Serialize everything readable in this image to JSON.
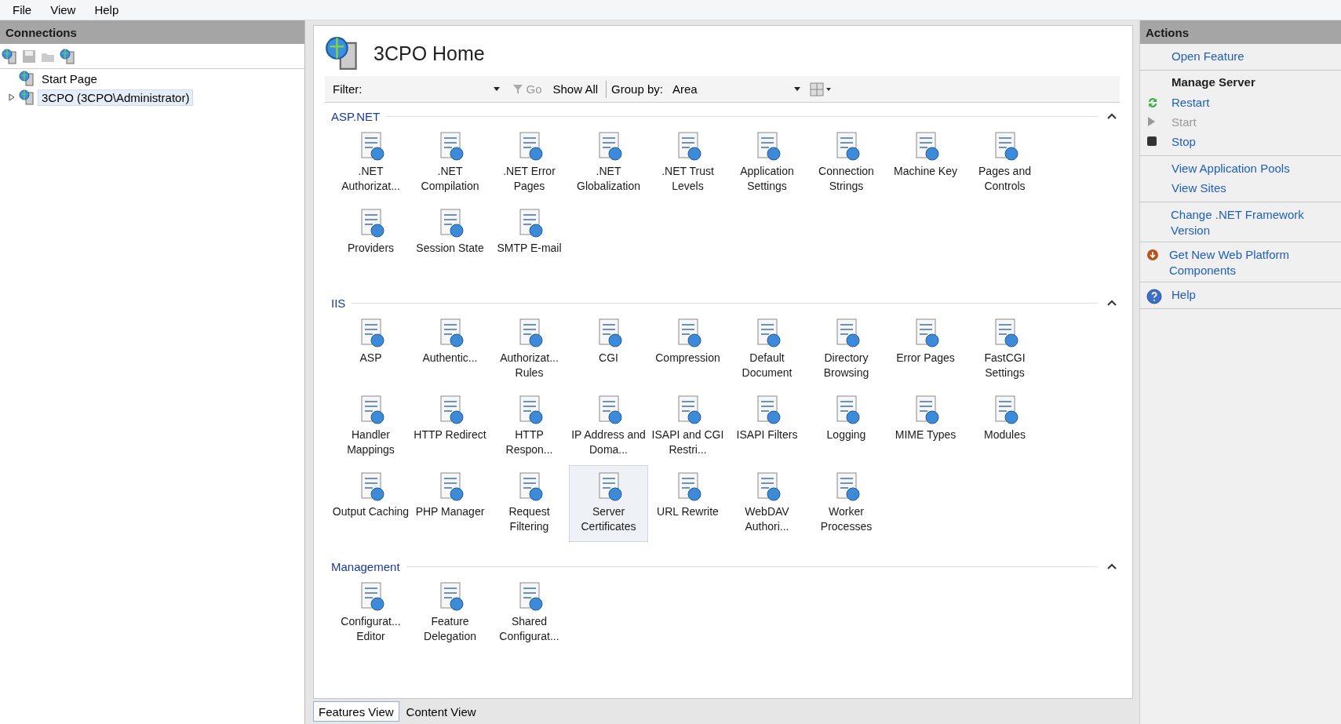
{
  "menu": [
    "File",
    "View",
    "Help"
  ],
  "connections": {
    "title": "Connections",
    "tree": [
      {
        "label": "Start Page",
        "selected": false
      },
      {
        "label": "3CPO (3CPO\\Administrator)",
        "selected": true,
        "expanded": false
      }
    ]
  },
  "home": {
    "title": "3CPO Home",
    "filter": {
      "label": "Filter:",
      "go": "Go",
      "show_all": "Show All",
      "group_label": "Group by:",
      "group_value": "Area"
    },
    "sections": [
      {
        "title": "ASP.NET",
        "expanded": true,
        "features": [
          {
            "label": ".NET Authorizat...",
            "selected": false
          },
          {
            "label": ".NET Compilation",
            "selected": false
          },
          {
            "label": ".NET Error Pages",
            "selected": false
          },
          {
            "label": ".NET Globalization",
            "selected": false
          },
          {
            "label": ".NET Trust Levels",
            "selected": false
          },
          {
            "label": "Application Settings",
            "selected": false
          },
          {
            "label": "Connection Strings",
            "selected": false
          },
          {
            "label": "Machine Key",
            "selected": false
          },
          {
            "label": "Pages and Controls",
            "selected": false
          },
          {
            "label": "Providers",
            "selected": false
          },
          {
            "label": "Session State",
            "selected": false
          },
          {
            "label": "SMTP E-mail",
            "selected": false
          }
        ]
      },
      {
        "title": "IIS",
        "expanded": true,
        "features": [
          {
            "label": "ASP",
            "selected": false
          },
          {
            "label": "Authentic...",
            "selected": false
          },
          {
            "label": "Authorizat... Rules",
            "selected": false
          },
          {
            "label": "CGI",
            "selected": false
          },
          {
            "label": "Compression",
            "selected": false
          },
          {
            "label": "Default Document",
            "selected": false
          },
          {
            "label": "Directory Browsing",
            "selected": false
          },
          {
            "label": "Error Pages",
            "selected": false
          },
          {
            "label": "FastCGI Settings",
            "selected": false
          },
          {
            "label": "Handler Mappings",
            "selected": false
          },
          {
            "label": "HTTP Redirect",
            "selected": false
          },
          {
            "label": "HTTP Respon...",
            "selected": false
          },
          {
            "label": "IP Address and Doma...",
            "selected": false
          },
          {
            "label": "ISAPI and CGI Restri...",
            "selected": false
          },
          {
            "label": "ISAPI Filters",
            "selected": false
          },
          {
            "label": "Logging",
            "selected": false
          },
          {
            "label": "MIME Types",
            "selected": false
          },
          {
            "label": "Modules",
            "selected": false
          },
          {
            "label": "Output Caching",
            "selected": false
          },
          {
            "label": "PHP Manager",
            "selected": false
          },
          {
            "label": "Request Filtering",
            "selected": false
          },
          {
            "label": "Server Certificates",
            "selected": true
          },
          {
            "label": "URL Rewrite",
            "selected": false
          },
          {
            "label": "WebDAV Authori...",
            "selected": false
          },
          {
            "label": "Worker Processes",
            "selected": false
          }
        ]
      },
      {
        "title": "Management",
        "expanded": true,
        "features": [
          {
            "label": "Configurat... Editor",
            "selected": false
          },
          {
            "label": "Feature Delegation",
            "selected": false
          },
          {
            "label": "Shared Configurat...",
            "selected": false
          }
        ]
      }
    ]
  },
  "view_tabs": [
    {
      "label": "Features View",
      "selected": true
    },
    {
      "label": "Content View",
      "selected": false
    }
  ],
  "actions": {
    "title": "Actions",
    "groups": [
      [
        {
          "kind": "link",
          "label": "Open Feature"
        }
      ],
      [
        {
          "kind": "header",
          "label": "Manage Server"
        },
        {
          "kind": "restart",
          "label": "Restart"
        },
        {
          "kind": "start",
          "label": "Start",
          "disabled": true
        },
        {
          "kind": "stop",
          "label": "Stop"
        }
      ],
      [
        {
          "kind": "link",
          "label": "View Application Pools"
        },
        {
          "kind": "link",
          "label": "View Sites"
        }
      ],
      [
        {
          "kind": "link",
          "label": "Change .NET Framework Version"
        }
      ],
      [
        {
          "kind": "download",
          "label": "Get New Web Platform Components"
        }
      ],
      [
        {
          "kind": "help",
          "label": "Help"
        }
      ]
    ]
  }
}
